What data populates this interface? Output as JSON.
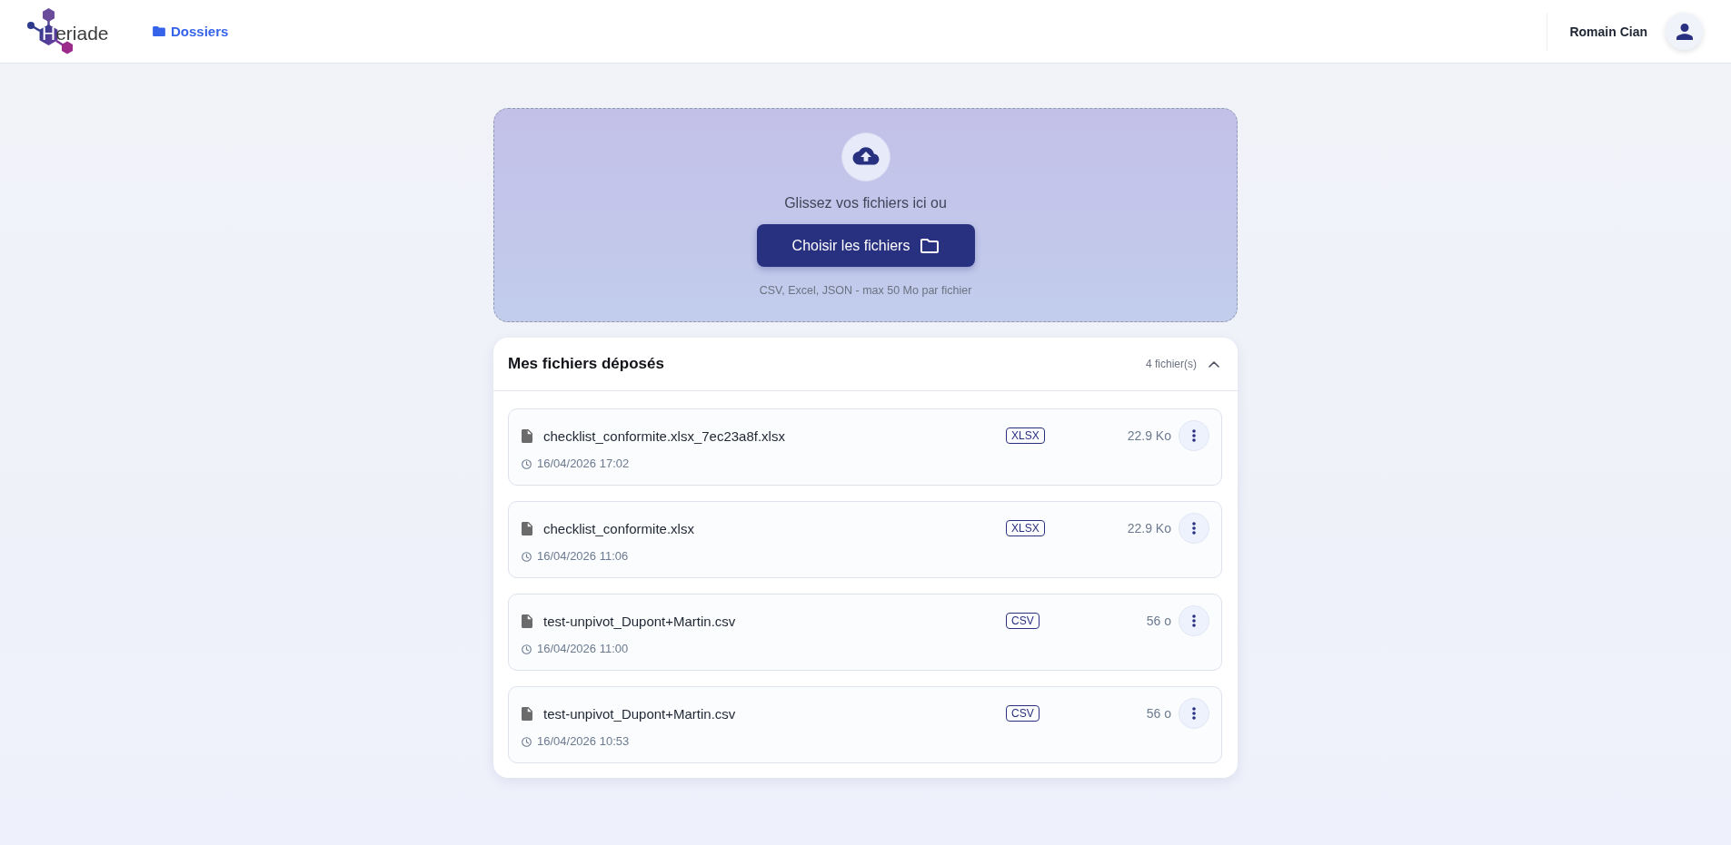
{
  "header": {
    "logo": "Heriade",
    "nav": [
      {
        "label": "Dossiers"
      }
    ],
    "user": {
      "name": "Romain Cian"
    }
  },
  "upload": {
    "prompt": "Glissez vos fichiers ici ou",
    "button": "Choisir les fichiers",
    "hint": "CSV, Excel, JSON - max 50 Mo par fichier"
  },
  "files": {
    "title": "Mes fichiers déposés",
    "count": "4 fichier(s)",
    "expanded": true,
    "items": [
      {
        "name": "checklist_conformite.xlsx_7ec23a8f.xlsx",
        "type": "XLSX",
        "size": "22.9 Ko",
        "date": "16/04/2026 17:02"
      },
      {
        "name": "checklist_conformite.xlsx",
        "type": "XLSX",
        "size": "22.9 Ko",
        "date": "16/04/2026 11:06"
      },
      {
        "name": "test-unpivot_Dupont+Martin.csv",
        "type": "CSV",
        "size": "56 o",
        "date": "16/04/2026 11:00"
      },
      {
        "name": "test-unpivot_Dupont+Martin.csv",
        "type": "CSV",
        "size": "56 o",
        "date": "16/04/2026 10:53"
      }
    ]
  }
}
